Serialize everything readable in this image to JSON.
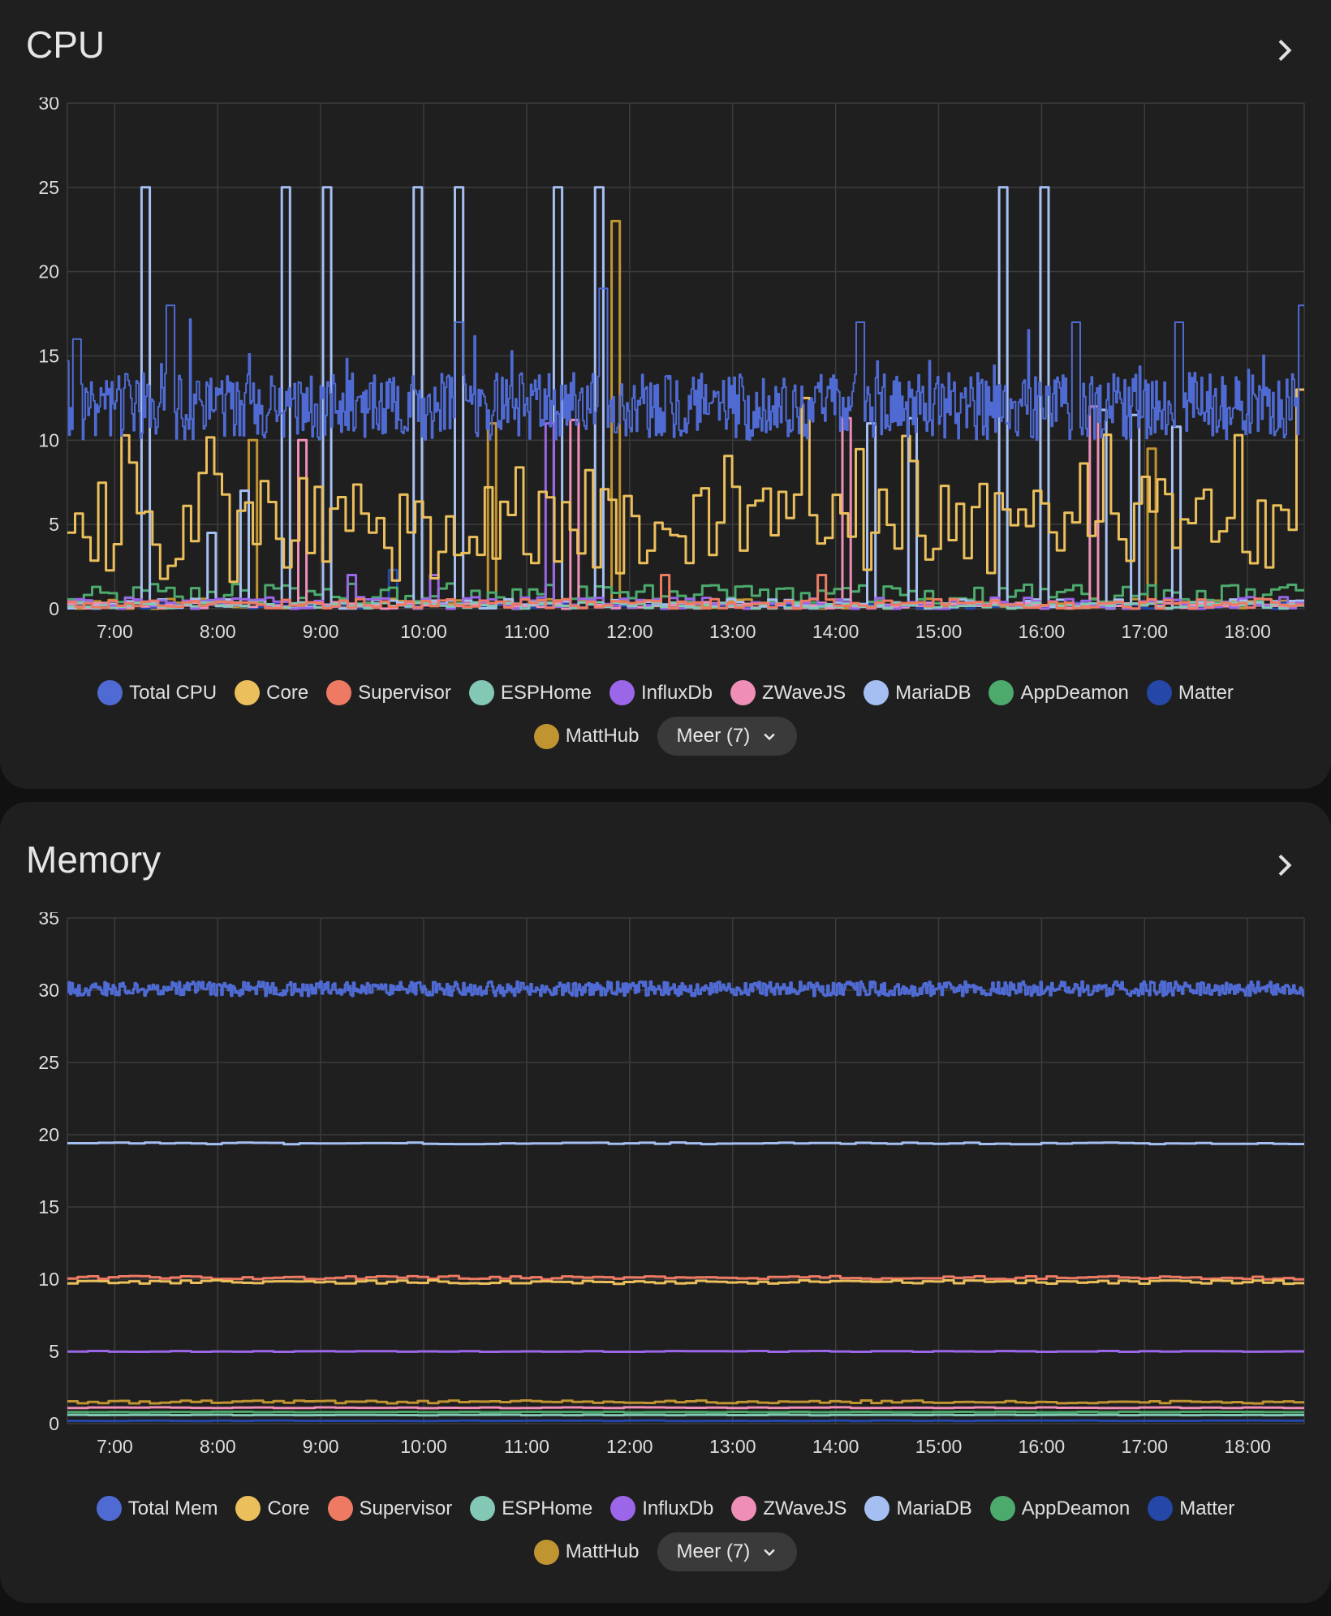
{
  "labels": {
    "more": "Meer (7)"
  },
  "chart_data": [
    {
      "type": "line",
      "title": "CPU",
      "ylabel": "%",
      "ylim": [
        0,
        30
      ],
      "yticks": [
        0,
        5,
        10,
        15,
        20,
        25,
        30
      ],
      "xlim_hours": [
        6.54,
        18.55
      ],
      "xticks": [
        "7:00",
        "8:00",
        "9:00",
        "10:00",
        "11:00",
        "12:00",
        "13:00",
        "14:00",
        "15:00",
        "16:00",
        "17:00",
        "18:00"
      ],
      "grid": true,
      "legend_position": "bottom",
      "series": [
        {
          "name": "Total CPU",
          "color": "#4f6bd3",
          "base": 12,
          "noise": 2,
          "min": 9,
          "points": 900,
          "spikes": [
            [
              6.6,
              16
            ],
            [
              7.5,
              18
            ],
            [
              10.3,
              17
            ],
            [
              11.7,
              19
            ],
            [
              14.2,
              17
            ],
            [
              16.3,
              17
            ],
            [
              17.3,
              17
            ],
            [
              18.5,
              18
            ]
          ]
        },
        {
          "name": "Core",
          "color": "#ebbf5b",
          "base": 4.5,
          "noise": 3,
          "min": 1,
          "points": 160,
          "spikes": [
            [
              13.7,
              12.5
            ],
            [
              18.45,
              13
            ]
          ]
        },
        {
          "name": "Supervisor",
          "color": "#ef7a63",
          "base": 0.3,
          "noise": 0.3,
          "min": 0,
          "points": 150,
          "spikes": [
            [
              12.3,
              2
            ],
            [
              13.8,
              2
            ]
          ]
        },
        {
          "name": "ESPHome",
          "color": "#83c7b5",
          "base": 0.2,
          "noise": 0.2,
          "min": 0,
          "points": 150,
          "spikes": []
        },
        {
          "name": "InfluxDb",
          "color": "#9b67e8",
          "base": 0.3,
          "noise": 0.4,
          "min": 0,
          "points": 150,
          "spikes": [
            [
              11.15,
              11
            ],
            [
              9.3,
              2
            ],
            [
              10.1,
              2
            ]
          ]
        },
        {
          "name": "ZWaveJS",
          "color": "#ef8fb8",
          "base": 0.2,
          "noise": 0.2,
          "min": 0,
          "points": 150,
          "spikes": [
            [
              8.75,
              10
            ],
            [
              11.4,
              11.2
            ],
            [
              14.05,
              11.3
            ],
            [
              16.5,
              12
            ]
          ]
        },
        {
          "name": "MariaDB",
          "color": "#a6bff2",
          "base": 0.3,
          "noise": 0.3,
          "min": 0,
          "points": 150,
          "spikes": [
            [
              7.25,
              25
            ],
            [
              8.6,
              25
            ],
            [
              9.02,
              25
            ],
            [
              9.88,
              25
            ],
            [
              10.3,
              25
            ],
            [
              11.23,
              25
            ],
            [
              11.65,
              25
            ],
            [
              15.56,
              25
            ],
            [
              16.0,
              25
            ],
            [
              14.3,
              11
            ],
            [
              14.72,
              11.3
            ],
            [
              16.55,
              11.8
            ],
            [
              16.85,
              11.5
            ],
            [
              17.27,
              10.8
            ],
            [
              8.2,
              7
            ],
            [
              7.9,
              4.5
            ]
          ]
        },
        {
          "name": "AppDeamon",
          "color": "#4caa6c",
          "base": 0.9,
          "noise": 0.6,
          "min": 0,
          "points": 150,
          "spikes": []
        },
        {
          "name": "Matter",
          "color": "#2447a8",
          "base": 0.2,
          "noise": 0.2,
          "min": 0,
          "points": 150,
          "spikes": [
            [
              9.7,
              2.3
            ]
          ]
        },
        {
          "name": "MattHub",
          "color": "#c19432",
          "base": 0.3,
          "noise": 0.3,
          "min": 0,
          "points": 150,
          "spikes": [
            [
              11.83,
              23
            ],
            [
              8.33,
              10
            ],
            [
              10.62,
              11
            ],
            [
              17.0,
              9.5
            ]
          ]
        }
      ]
    },
    {
      "type": "line",
      "title": "Memory",
      "ylabel": "%",
      "ylim": [
        0,
        35
      ],
      "yticks": [
        0,
        5,
        10,
        15,
        20,
        25,
        30,
        35
      ],
      "xlim_hours": [
        6.54,
        18.55
      ],
      "xticks": [
        "7:00",
        "8:00",
        "9:00",
        "10:00",
        "11:00",
        "12:00",
        "13:00",
        "14:00",
        "15:00",
        "16:00",
        "17:00",
        "18:00"
      ],
      "grid": true,
      "legend_position": "bottom",
      "series": [
        {
          "name": "Total Mem",
          "color": "#4f6bd3",
          "base": 30.1,
          "noise": 0.5,
          "min": 0,
          "points": 900,
          "spikes": []
        },
        {
          "name": "Core",
          "color": "#ebbf5b",
          "base": 9.8,
          "noise": 0.12,
          "min": 0,
          "points": 120,
          "spikes": []
        },
        {
          "name": "Supervisor",
          "color": "#ef7a63",
          "base": 10.1,
          "noise": 0.12,
          "min": 0,
          "points": 120,
          "spikes": []
        },
        {
          "name": "ESPHome",
          "color": "#83c7b5",
          "base": 0.6,
          "noise": 0.02,
          "min": 0,
          "points": 60,
          "spikes": []
        },
        {
          "name": "InfluxDb",
          "color": "#9b67e8",
          "base": 5.0,
          "noise": 0.03,
          "min": 0,
          "points": 60,
          "spikes": []
        },
        {
          "name": "ZWaveJS",
          "color": "#ef8fb8",
          "base": 1.1,
          "noise": 0.03,
          "min": 0,
          "points": 60,
          "spikes": []
        },
        {
          "name": "MariaDB",
          "color": "#a6bff2",
          "base": 19.4,
          "noise": 0.06,
          "min": 0,
          "points": 80,
          "spikes": []
        },
        {
          "name": "AppDeamon",
          "color": "#4caa6c",
          "base": 0.8,
          "noise": 0.02,
          "min": 0,
          "points": 60,
          "spikes": []
        },
        {
          "name": "Matter",
          "color": "#2447a8",
          "base": 0.2,
          "noise": 0.02,
          "min": 0,
          "points": 60,
          "spikes": []
        },
        {
          "name": "MattHub",
          "color": "#c19432",
          "base": 1.5,
          "noise": 0.1,
          "min": 0,
          "points": 120,
          "spikes": []
        }
      ]
    }
  ]
}
